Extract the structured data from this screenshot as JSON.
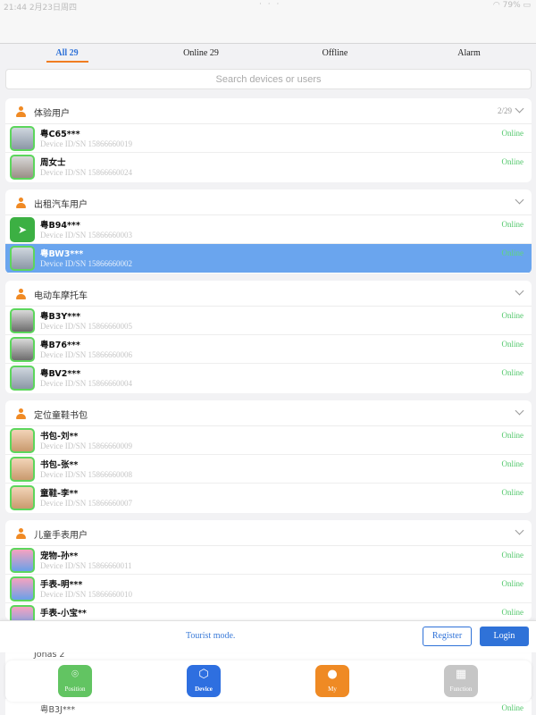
{
  "statusbar": {
    "time": "21:44",
    "date": "2月23日周四",
    "dots": "· · ·",
    "right": "◠ 79% ▭"
  },
  "tabs": [
    {
      "label": "All 29",
      "active": true
    },
    {
      "label": "Online 29",
      "active": false
    },
    {
      "label": "Offline",
      "active": false
    },
    {
      "label": "Alarm",
      "active": false
    }
  ],
  "search": {
    "placeholder": "Search devices or users"
  },
  "groups": [
    {
      "name": "体验用户",
      "count": "2/29",
      "devices": [
        {
          "name": "粤C65***",
          "sn": "Device ID/SN 15866660019",
          "status": "Online",
          "icon": "car-photo"
        },
        {
          "name": "周女士",
          "sn": "Device ID/SN 15866660024",
          "status": "Online",
          "icon": "person-photo"
        }
      ]
    },
    {
      "name": "出租汽车用户",
      "devices": [
        {
          "name": "粤B94***",
          "sn": "Device ID/SN 15866660003",
          "status": "Online",
          "icon": "paper-plane-icon"
        },
        {
          "name": "粤BW3***",
          "sn": "Device ID/SN 15866660002",
          "status": "Online",
          "icon": "car-photo",
          "selected": true
        }
      ]
    },
    {
      "name": "电动车摩托车",
      "devices": [
        {
          "name": "粤B3Y***",
          "sn": "Device ID/SN 15866660005",
          "status": "Online",
          "icon": "motorbike-photo"
        },
        {
          "name": "粤B76***",
          "sn": "Device ID/SN 15866660006",
          "status": "Online",
          "icon": "scooter-photo"
        },
        {
          "name": "粤BV2***",
          "sn": "Device ID/SN 15866660004",
          "status": "Online",
          "icon": "car-photo"
        }
      ]
    },
    {
      "name": "定位童鞋书包",
      "devices": [
        {
          "name": "书包-刘**",
          "sn": "Device ID/SN 15866660009",
          "status": "Online",
          "icon": "child-photo"
        },
        {
          "name": "书包-张**",
          "sn": "Device ID/SN 15866660008",
          "status": "Online",
          "icon": "child-photo"
        },
        {
          "name": "童鞋-李**",
          "sn": "Device ID/SN 15866660007",
          "status": "Online",
          "icon": "child-photo"
        }
      ]
    },
    {
      "name": "儿童手表用户",
      "devices": [
        {
          "name": "宠物-孙**",
          "sn": "Device ID/SN 15866660011",
          "status": "Online",
          "icon": "watch-photo"
        },
        {
          "name": "手表-明***",
          "sn": "Device ID/SN 15866660010",
          "status": "Online",
          "icon": "watch-photo"
        },
        {
          "name": "手表-小宝**",
          "sn": "",
          "status": "Online",
          "icon": "watch-photo"
        }
      ]
    }
  ],
  "peek_rows": [
    {
      "name": "Jonas 2",
      "status": ""
    },
    {
      "name": "粤B3J***",
      "status": "Online"
    }
  ],
  "banner": {
    "message": "Tourist mode.",
    "register": "Register",
    "login": "Login"
  },
  "tabbar": [
    {
      "label": "Position",
      "icon": "location-pin-icon",
      "color": "#62c462"
    },
    {
      "label": "Device",
      "icon": "cube-icon",
      "color": "#2e6fe0",
      "active": true
    },
    {
      "label": "My",
      "icon": "person-icon",
      "color": "#ef8a24"
    },
    {
      "label": "Function",
      "icon": "grid-icon",
      "color": "#c6c6c6"
    }
  ],
  "colors": {
    "accent": "#2f72d8",
    "online": "#52c76b",
    "selected_row": "#6aa5ee",
    "tab_indicator": "#f07d21"
  }
}
